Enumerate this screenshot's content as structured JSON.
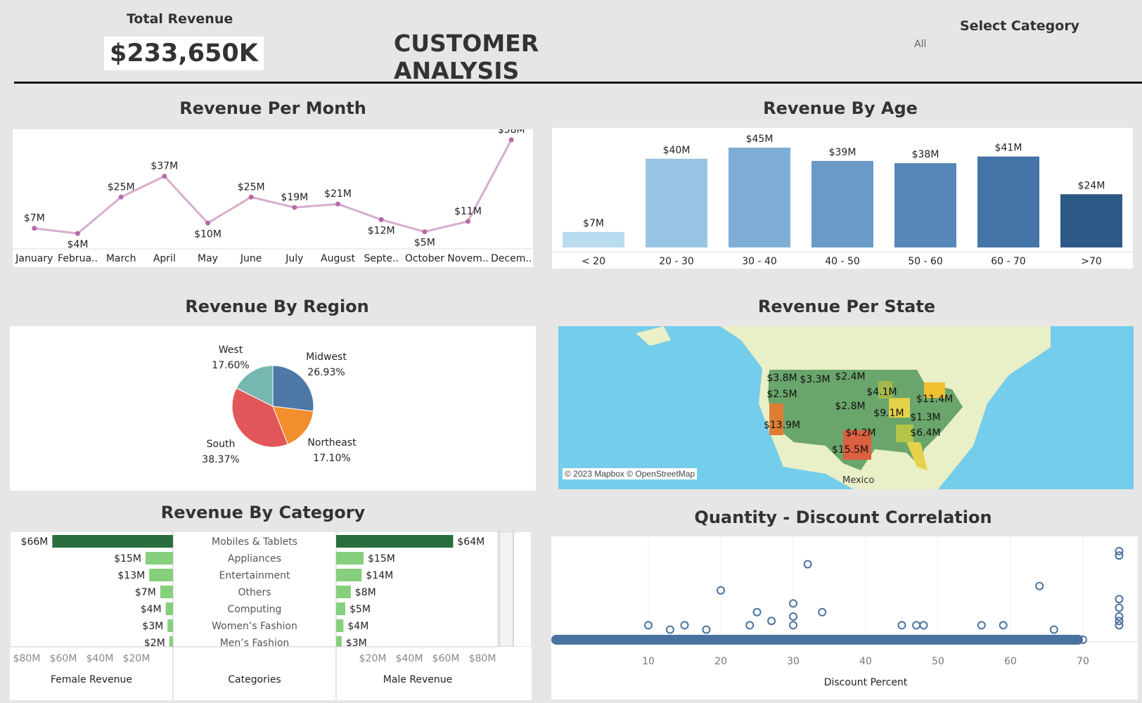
{
  "header": {
    "kpi_label": "Total Revenue",
    "kpi_value": "$233,650K",
    "title": "CUSTOMER ANALYSIS",
    "filter_label": "Select Category",
    "filter_value": "All"
  },
  "titles": {
    "month": "Revenue Per Month",
    "age": "Revenue By Age",
    "region": "Revenue By Region",
    "state": "Revenue Per State",
    "category": "Revenue By Category",
    "scatter": "Quantity - Discount Correlation"
  },
  "map": {
    "attribution": "© 2023 Mapbox © OpenStreetMap",
    "mexico_label": "Mexico",
    "labels": [
      "$3.8M",
      "$3.3M",
      "$2.4M",
      "$2.5M",
      "$4.1M",
      "$11.4M",
      "$2.8M",
      "$9.1M",
      "$1.3M",
      "$13.9M",
      "$4.2M",
      "$6.4M",
      "$15.5M"
    ]
  },
  "category_axis": {
    "female_label": "Female Revenue",
    "male_label": "Male Revenue",
    "categories_label": "Categories",
    "female_ticks": [
      "$80M",
      "$60M",
      "$40M",
      "$20M"
    ],
    "male_ticks": [
      "$20M",
      "$40M",
      "$60M",
      "$80M"
    ]
  },
  "chart_data": [
    {
      "id": "month",
      "type": "line",
      "title": "Revenue Per Month",
      "categories": [
        "January",
        "Februa..",
        "March",
        "April",
        "May",
        "June",
        "July",
        "August",
        "Septe..",
        "October",
        "Novem..",
        "Decem.."
      ],
      "values": [
        7,
        4,
        25,
        37,
        10,
        25,
        19,
        21,
        12,
        5,
        11,
        58
      ],
      "labels": [
        "$7M",
        "$4M",
        "$25M",
        "$37M",
        "$10M",
        "$25M",
        "$19M",
        "$21M",
        "$12M",
        "$5M",
        "$11M",
        "$58M"
      ],
      "unit": "$M",
      "color": "#b56aa6"
    },
    {
      "id": "age",
      "type": "bar",
      "title": "Revenue By Age",
      "categories": [
        "< 20",
        "20 - 30",
        "30 - 40",
        "40 - 50",
        "50 - 60",
        "60 - 70",
        ">70"
      ],
      "values": [
        7,
        40,
        45,
        39,
        38,
        41,
        24
      ],
      "labels": [
        "$7M",
        "$40M",
        "$45M",
        "$39M",
        "$38M",
        "$41M",
        "$24M"
      ],
      "colors": [
        "#b9dcf0",
        "#9ac4e4",
        "#7eaed6",
        "#6a9bc8",
        "#5786b8",
        "#4474a8",
        "#2e5987"
      ]
    },
    {
      "id": "region",
      "type": "pie",
      "title": "Revenue By Region",
      "slices": [
        {
          "name": "Midwest",
          "pct": 26.93,
          "label": "26.93%",
          "color": "#4e79a7"
        },
        {
          "name": "Northeast",
          "pct": 17.1,
          "label": "17.10%",
          "color": "#f28e2b"
        },
        {
          "name": "South",
          "pct": 38.37,
          "label": "38.37%",
          "color": "#e15759"
        },
        {
          "name": "West",
          "pct": 17.6,
          "label": "17.60%",
          "color": "#76b7b2"
        }
      ]
    },
    {
      "id": "category",
      "type": "bar",
      "title": "Revenue By Category",
      "categories": [
        "Mobiles & Tablets",
        "Appliances",
        "Entertainment",
        "Others",
        "Computing",
        "Women’s Fashion",
        "Men’s Fashion"
      ],
      "series": [
        {
          "name": "Female Revenue",
          "values": [
            66,
            15,
            13,
            7,
            4,
            3,
            2
          ],
          "labels": [
            "$66M",
            "$15M",
            "$13M",
            "$7M",
            "$4M",
            "$3M",
            "$2M"
          ]
        },
        {
          "name": "Male Revenue",
          "values": [
            64,
            15,
            14,
            8,
            5,
            4,
            3
          ],
          "labels": [
            "$64M",
            "$15M",
            "$14M",
            "$8M",
            "$5M",
            "$4M",
            "$3M"
          ]
        }
      ],
      "xlim": [
        0,
        80
      ],
      "colors": {
        "top": "#2a6e3f",
        "other": "#86cf7c"
      }
    },
    {
      "id": "scatter",
      "type": "scatter",
      "title": "Quantity - Discount Correlation",
      "xlabel": "Discount Percent",
      "xlim": [
        0,
        75
      ],
      "xticks": [
        10,
        20,
        30,
        40,
        50,
        60,
        70
      ],
      "outliers": [
        [
          10,
          3
        ],
        [
          13,
          2
        ],
        [
          15,
          3
        ],
        [
          18,
          2
        ],
        [
          20,
          11
        ],
        [
          24,
          3
        ],
        [
          25,
          6
        ],
        [
          27,
          4
        ],
        [
          30,
          5
        ],
        [
          30,
          8
        ],
        [
          30,
          3
        ],
        [
          32,
          17
        ],
        [
          34,
          6
        ],
        [
          45,
          3
        ],
        [
          47,
          3
        ],
        [
          48,
          3
        ],
        [
          56,
          3
        ],
        [
          59,
          3
        ],
        [
          64,
          12
        ],
        [
          66,
          2
        ],
        [
          75,
          20
        ],
        [
          75,
          19
        ],
        [
          75,
          9
        ],
        [
          75,
          7
        ],
        [
          75,
          5
        ],
        [
          75,
          4
        ],
        [
          75,
          3
        ]
      ],
      "color": "#4a72a0"
    }
  ]
}
